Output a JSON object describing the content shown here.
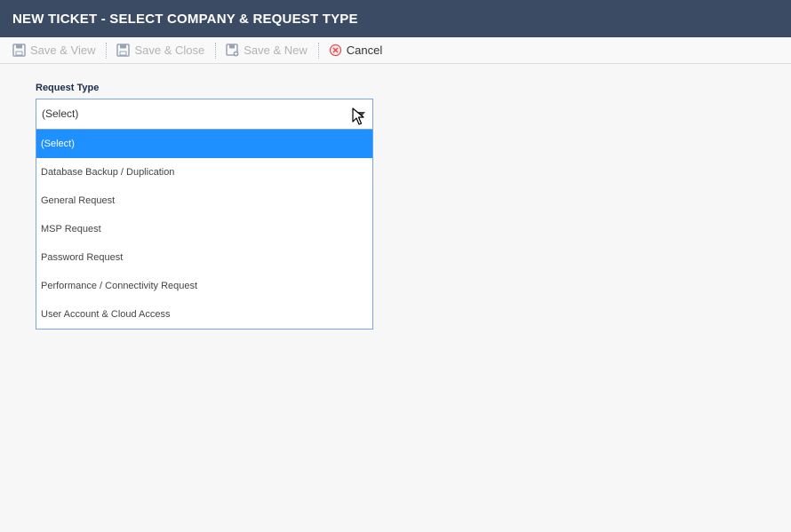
{
  "window": {
    "title": "NEW TICKET - SELECT COMPANY & REQUEST TYPE"
  },
  "toolbar": {
    "save_view": {
      "label": "Save & View",
      "icon": "save-icon",
      "enabled": false
    },
    "save_close": {
      "label": "Save & Close",
      "icon": "save-icon",
      "enabled": false
    },
    "save_new": {
      "label": "Save & New",
      "icon": "save-new-icon",
      "enabled": false
    },
    "cancel": {
      "label": "Cancel",
      "icon": "cancel-icon",
      "enabled": true
    }
  },
  "form": {
    "request_type": {
      "label": "Request Type",
      "value": "(Select)",
      "options": [
        "(Select)",
        "Database Backup / Duplication",
        "General Request",
        "MSP Request",
        "Password Request",
        "Performance / Connectivity Request",
        "User Account & Cloud Access"
      ],
      "highlighted_option": "(Select)"
    }
  },
  "colors": {
    "titlebar": "#3c4b64",
    "highlight": "#1e90ff",
    "border_focus": "#79a6df",
    "cancel_icon": "#d9534f"
  }
}
